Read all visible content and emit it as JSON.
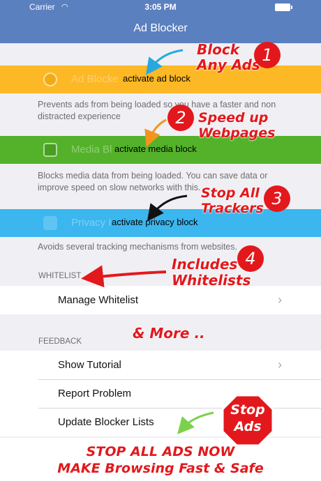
{
  "status_bar": {
    "carrier": "Carrier",
    "time": "3:05 PM"
  },
  "nav": {
    "title": "Ad Blocker"
  },
  "blockers": [
    {
      "ghost_label": "Ad Blocke",
      "action": "activate ad block",
      "description": "Prevents ads from being loaded so you have a faster and non distracted experience",
      "color": "#fdb825",
      "icon": "block-icon"
    },
    {
      "ghost_label": "Media Bl",
      "action": "activate media block",
      "description": "Blocks media data from being loaded. You can save data or improve speed on slow networks with this.",
      "color": "#54b22a",
      "icon": "image-icon"
    },
    {
      "ghost_label": "Privacy B",
      "action": "activate privacy block",
      "description": "Avoids several tracking mechanisms from websites.",
      "color": "#3bb6ee",
      "icon": "person-icon"
    }
  ],
  "whitelist": {
    "header": "WHITELIST",
    "items": [
      "Manage Whitelist"
    ]
  },
  "feedback": {
    "header": "FEEDBACK",
    "items": [
      "Show Tutorial",
      "Report Problem",
      "Update Blocker Lists"
    ]
  },
  "promo": {
    "callout_1": "Block\nAny Ads",
    "callout_2": "Speed up\nWebpages",
    "callout_3": "Stop All\nTrackers",
    "callout_4": "Includes\nWhitelists",
    "more": "& More ..",
    "badges": [
      "1",
      "2",
      "3",
      "4"
    ],
    "stop_sign": "Stop\nAds",
    "footer_line_1": "STOP ALL ADS NOW",
    "footer_line_2": "MAKE Browsing Fast & Safe",
    "accent": "#e3181c"
  }
}
